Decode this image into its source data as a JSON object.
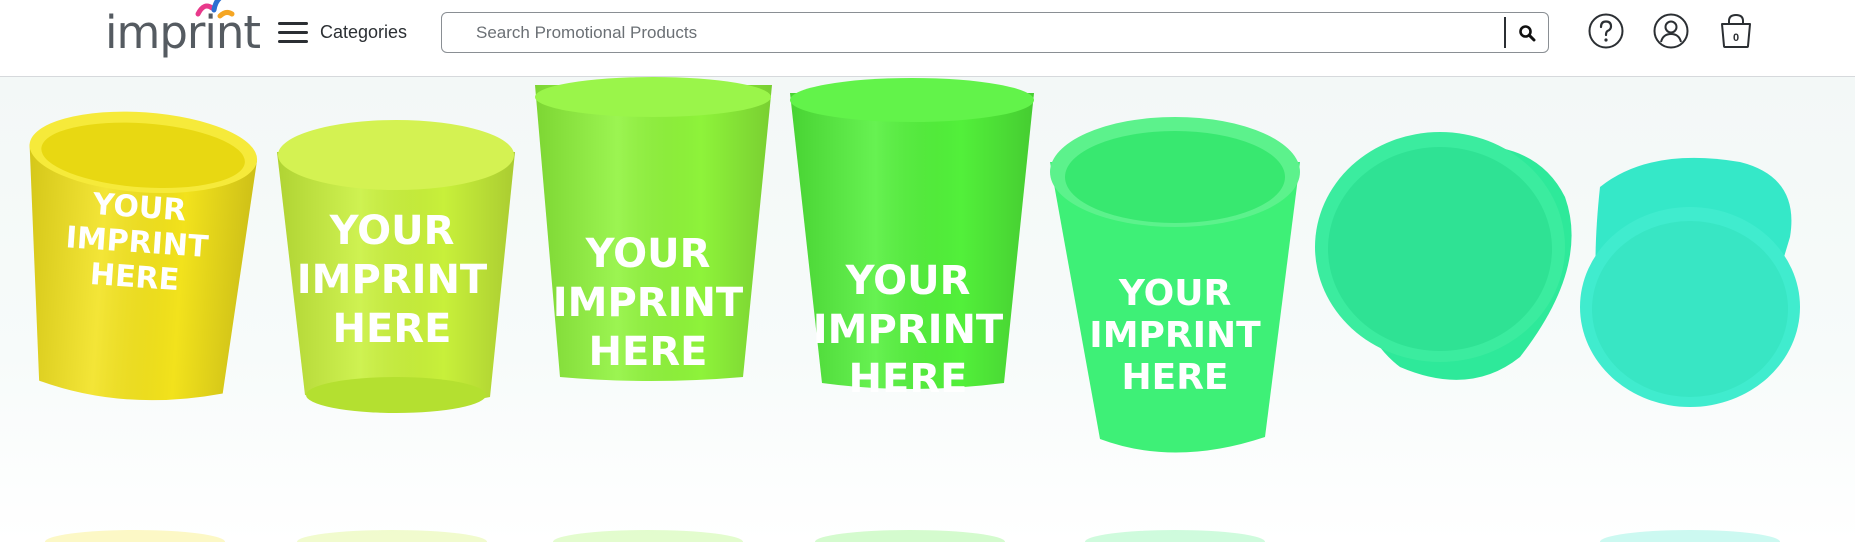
{
  "logo": {
    "text": "imprint",
    "icon": "imprint-logo-mark"
  },
  "header": {
    "menu_label": "Categories",
    "menu_icon": "hamburger-icon",
    "search": {
      "placeholder": "Search Promotional Products",
      "value": "",
      "button_icon": "search-icon"
    },
    "help_icon": "help-icon",
    "account_icon": "account-icon",
    "cart": {
      "icon": "cart-bag-icon",
      "count": "0"
    }
  },
  "hero": {
    "cup_imprint_lines": [
      "YOUR",
      "IMPRINT",
      "HERE"
    ],
    "cup_colors": [
      "#f2e21c",
      "#c8f03a",
      "#8ef33a",
      "#52f03a",
      "#3ef077",
      "#2ee99a",
      "#35e8c8"
    ]
  }
}
